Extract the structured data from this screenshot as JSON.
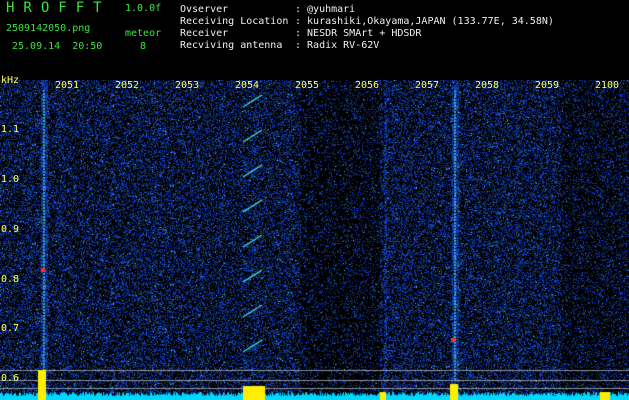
{
  "header": {
    "logo": "HROFFT",
    "version": "1.0.0f",
    "filename": "2509142050.png",
    "datetime": "25.09.14  20:50",
    "meteor_label": "meteor",
    "meteor_count": "8",
    "fields": [
      {
        "label": "Ovserver",
        "value": ": @yuhmari"
      },
      {
        "label": "Receiving Location",
        "value": ": kurashiki,Okayama,JAPAN (133.77E, 34.58N)"
      },
      {
        "label": "Receiver",
        "value": ": NESDR SMArt + HDSDR"
      },
      {
        "label": "Recviving antenna",
        "value": ": Radix RV-62V"
      }
    ]
  },
  "axis": {
    "unit": "kHz",
    "y_ticks": [
      "1.1",
      "1.0",
      "0.9",
      "0.8",
      "0.7",
      "0.6"
    ],
    "x_ticks": [
      "2051",
      "2052",
      "2053",
      "2054",
      "2055",
      "2056",
      "2057",
      "2058",
      "2059",
      "2100"
    ]
  },
  "colors": {
    "background": "#000000",
    "noise": "#1a2fb0",
    "signal": "#39e6e6",
    "label": "#ffff66",
    "baseline": "#00d8ff",
    "peak": "#ffee00"
  }
}
